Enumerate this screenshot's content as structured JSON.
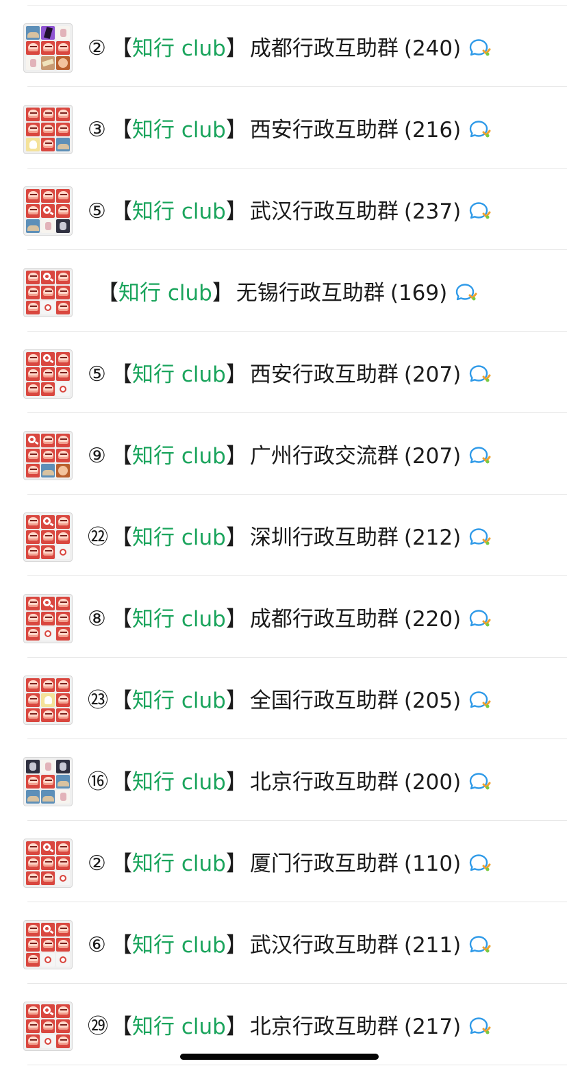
{
  "groups": [
    {
      "prefix": "②",
      "bracket_left": "【",
      "brand": "知行 club",
      "bracket_right": "】",
      "name": "成都行政互助群",
      "count": "(240)",
      "avatar_tiles": [
        "b",
        "p",
        "w",
        "r",
        "r",
        "r",
        "w",
        "t",
        "f"
      ]
    },
    {
      "prefix": "③",
      "bracket_left": "【",
      "brand": "知行 club",
      "bracket_right": "】",
      "name": "西安行政互助群",
      "count": "(216)",
      "avatar_tiles": [
        "r",
        "r",
        "r",
        "r",
        "r",
        "r",
        "y",
        "r",
        "b"
      ]
    },
    {
      "prefix": "⑤",
      "bracket_left": "【",
      "brand": "知行 club",
      "bracket_right": "】",
      "name": "武汉行政互助群",
      "count": "(237)",
      "avatar_tiles": [
        "r",
        "r",
        "r",
        "r",
        "q",
        "r",
        "b",
        "w",
        "d"
      ]
    },
    {
      "prefix": "",
      "bracket_left": "【",
      "brand": "知行 club",
      "bracket_right": "】",
      "name": "无锡行政互助群",
      "count": "(169)",
      "avatar_tiles": [
        "r",
        "q",
        "r",
        "r",
        "r",
        "r",
        "r",
        "o",
        "r"
      ]
    },
    {
      "prefix": "⑤",
      "bracket_left": "【",
      "brand": "知行 club",
      "bracket_right": "】",
      "name": "西安行政互助群",
      "count": "(207)",
      "avatar_tiles": [
        "r",
        "q",
        "r",
        "r",
        "r",
        "r",
        "r",
        "r",
        "o"
      ]
    },
    {
      "prefix": "⑨",
      "bracket_left": "【",
      "brand": "知行 club",
      "bracket_right": "】",
      "name": "广州行政交流群",
      "count": "(207)",
      "avatar_tiles": [
        "q",
        "r",
        "r",
        "r",
        "r",
        "r",
        "r",
        "b",
        "f"
      ]
    },
    {
      "prefix": "㉒",
      "bracket_left": "【",
      "brand": "知行 club",
      "bracket_right": "】",
      "name": "深圳行政互助群",
      "count": "(212)",
      "avatar_tiles": [
        "r",
        "q",
        "r",
        "r",
        "r",
        "r",
        "r",
        "r",
        "o"
      ]
    },
    {
      "prefix": "⑧",
      "bracket_left": "【",
      "brand": "知行 club",
      "bracket_right": "】",
      "name": "成都行政互助群",
      "count": "(220)",
      "avatar_tiles": [
        "r",
        "q",
        "r",
        "r",
        "r",
        "r",
        "r",
        "o",
        "r"
      ]
    },
    {
      "prefix": "㉓",
      "bracket_left": "【",
      "brand": "知行 club",
      "bracket_right": "】",
      "name": "全国行政互助群",
      "count": "(205)",
      "avatar_tiles": [
        "r",
        "r",
        "r",
        "r",
        "y",
        "r",
        "r",
        "r",
        "r"
      ]
    },
    {
      "prefix": "⑯",
      "bracket_left": "【",
      "brand": "知行 club",
      "bracket_right": "】",
      "name": "北京行政互助群",
      "count": "(200)",
      "avatar_tiles": [
        "d",
        "w",
        "d",
        "r",
        "r",
        "b",
        "b",
        "b",
        "w"
      ]
    },
    {
      "prefix": "②",
      "bracket_left": "【",
      "brand": "知行 club",
      "bracket_right": "】",
      "name": "厦门行政互助群",
      "count": "(110)",
      "avatar_tiles": [
        "r",
        "q",
        "r",
        "r",
        "r",
        "r",
        "r",
        "r",
        "o"
      ]
    },
    {
      "prefix": "⑥",
      "bracket_left": "【",
      "brand": "知行 club",
      "bracket_right": "】",
      "name": "武汉行政互助群",
      "count": "(211)",
      "avatar_tiles": [
        "r",
        "q",
        "r",
        "r",
        "r",
        "r",
        "r",
        "o",
        "o"
      ]
    },
    {
      "prefix": "㉙",
      "bracket_left": "【",
      "brand": "知行 club",
      "bracket_right": "】",
      "name": "北京行政互助群",
      "count": "(217)",
      "avatar_tiles": [
        "r",
        "q",
        "r",
        "r",
        "r",
        "r",
        "r",
        "o",
        "r"
      ]
    }
  ],
  "icons": {
    "avatar": "group-avatar-grid",
    "chat": "chat-bubble-icon"
  },
  "colors": {
    "brand": "#1aa45c",
    "text": "#1b1b1b",
    "divider": "#e6e6e6",
    "avatar_red": "#d9473f",
    "chat_blue": "#2f9ae8",
    "chat_orange": "#f0a12d"
  }
}
